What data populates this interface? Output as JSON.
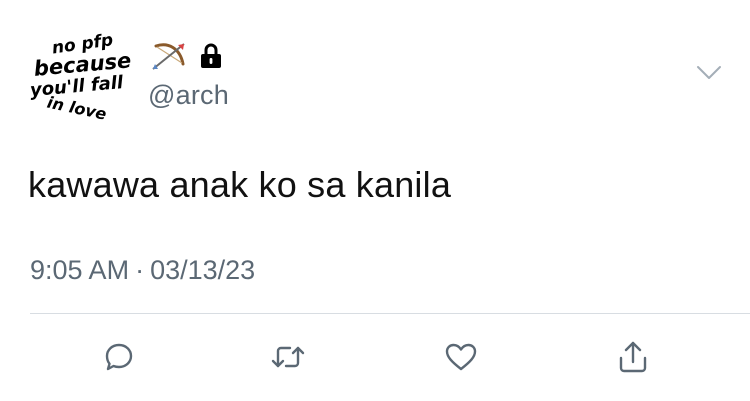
{
  "avatar": {
    "lines": [
      "no pfp",
      "because",
      "you'll fall",
      "in love"
    ]
  },
  "user": {
    "emoji_icon": "bow-and-arrow-icon",
    "protected_icon": "lock-icon",
    "handle": "@arch"
  },
  "tweet": {
    "text": "kawawa anak ko sa kanila",
    "time": "9:05 AM",
    "separator": "·",
    "date": "03/13/23"
  },
  "actions": {
    "reply_icon": "reply-icon",
    "retweet_icon": "retweet-icon",
    "like_icon": "heart-icon",
    "share_icon": "share-icon"
  },
  "colors": {
    "text": "#111111",
    "secondary": "#5b6874",
    "divider": "#d8dde2"
  }
}
